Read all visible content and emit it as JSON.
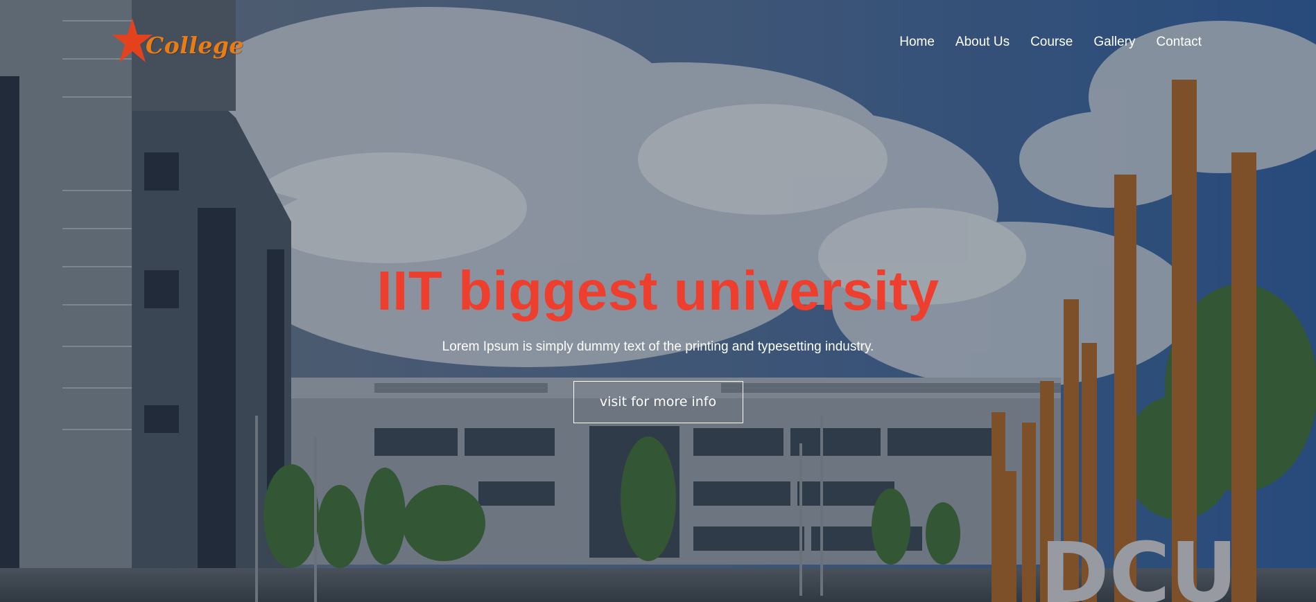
{
  "brand": {
    "logo_text": "College",
    "logo_color": "#ea7c16"
  },
  "nav": {
    "items": [
      {
        "label": "Home"
      },
      {
        "label": "About Us"
      },
      {
        "label": "Course"
      },
      {
        "label": "Gallery"
      },
      {
        "label": "Contact"
      }
    ]
  },
  "hero": {
    "title": "IIT biggest university",
    "title_color": "#ee3e2e",
    "subtitle": "Lorem Ipsum is simply dummy text of the printing and typesetting industry.",
    "button_label": "visit for more info",
    "background_sign": "DCU"
  },
  "icons": {
    "logo_mark": "star-icon"
  }
}
